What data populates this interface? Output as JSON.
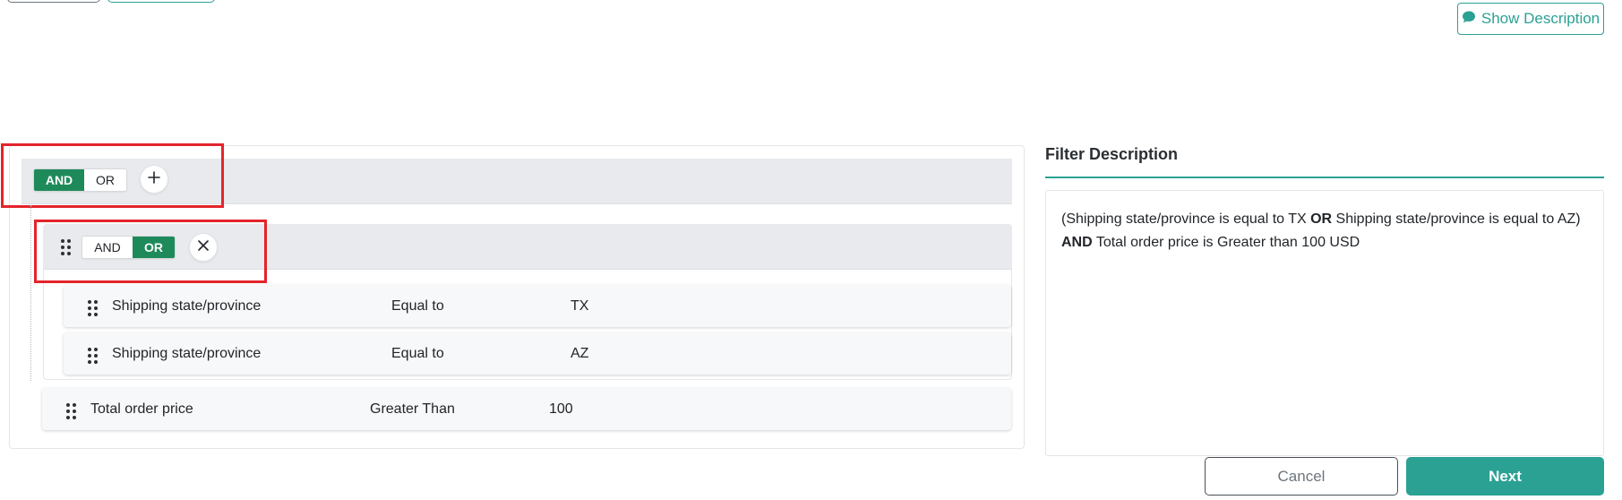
{
  "header": {
    "show_description_label": "Show Description"
  },
  "query_builder": {
    "root_group": {
      "and_label": "AND",
      "or_label": "OR",
      "selected": "AND"
    },
    "nested_group": {
      "and_label": "AND",
      "or_label": "OR",
      "selected": "OR",
      "rules": [
        {
          "field": "Shipping state/province",
          "operator": "Equal to",
          "value": "TX"
        },
        {
          "field": "Shipping state/province",
          "operator": "Equal to",
          "value": "AZ"
        }
      ]
    },
    "root_rules": [
      {
        "field": "Total order price",
        "operator": "Greater Than",
        "value": "100"
      }
    ]
  },
  "filter_description": {
    "title": "Filter Description",
    "line1_a": "(Shipping state/province is equal to TX ",
    "line1_op": "OR",
    "line1_b": " Shipping state/province is equal to AZ)",
    "line2_op": "AND",
    "line2_b": " Total order price is Greater than 100 USD"
  },
  "footer": {
    "cancel_label": "Cancel",
    "next_label": "Next"
  },
  "colors": {
    "accent": "#2ba194",
    "toggle_active": "#1e8a5a",
    "highlight_box": "#e3242b"
  }
}
